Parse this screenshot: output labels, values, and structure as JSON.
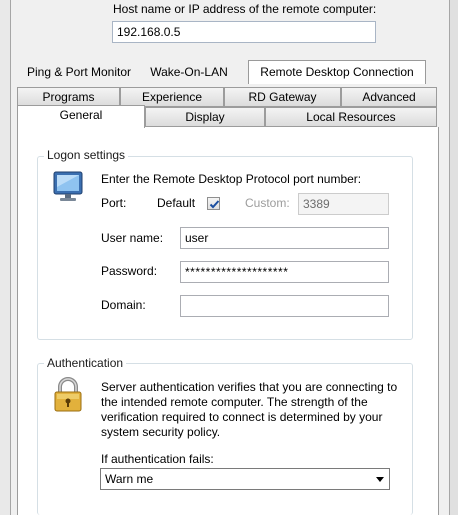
{
  "host": {
    "label": "Host name or IP address of the remote computer:",
    "value": "192.168.0.5"
  },
  "top_tabs": [
    {
      "label": "Ping & Port Monitor"
    },
    {
      "label": "Wake-On-LAN"
    },
    {
      "label": "Remote Desktop Connection"
    }
  ],
  "sub_tabs_row1": [
    {
      "label": "Programs"
    },
    {
      "label": "Experience"
    },
    {
      "label": "RD Gateway"
    },
    {
      "label": "Advanced"
    }
  ],
  "sub_tabs_row2": [
    {
      "label": "General"
    },
    {
      "label": "Display"
    },
    {
      "label": "Local Resources"
    }
  ],
  "logon": {
    "title": "Logon settings",
    "description": "Enter the Remote Desktop Protocol port number:",
    "port_label": "Port:",
    "default_label": "Default",
    "default_checked": true,
    "custom_label": "Custom:",
    "custom_value": "3389",
    "username_label": "User name:",
    "username_value": "user",
    "password_label": "Password:",
    "password_value": "********************",
    "domain_label": "Domain:",
    "domain_value": ""
  },
  "auth": {
    "title": "Authentication",
    "description_lines": [
      "Server authentication verifies that you are connecting to",
      "the intended remote computer. The strength of the",
      "verification required to connect is determined by your",
      "system security policy."
    ],
    "fail_label": "If authentication fails:",
    "fail_value": "Warn me"
  },
  "icons": {
    "monitor": "monitor-icon",
    "padlock": "padlock-icon"
  },
  "colors": {
    "group_border": "#d5dfe5",
    "checkmark": "#1c4fa0"
  }
}
